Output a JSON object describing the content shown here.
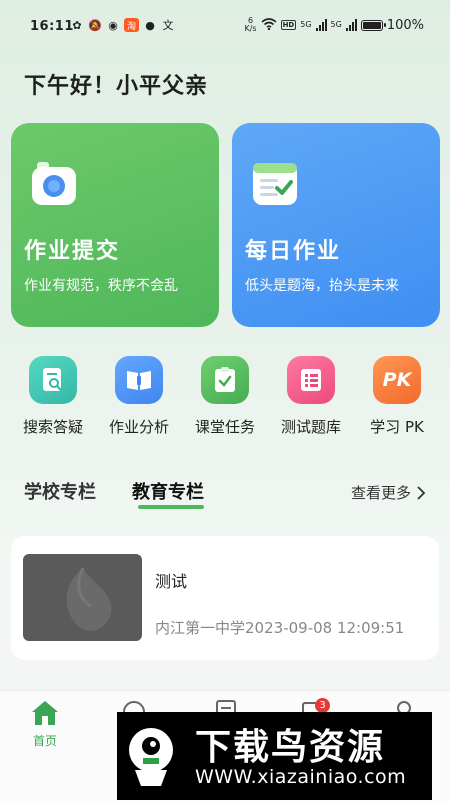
{
  "status_bar": {
    "time": "16:11",
    "net_speed_value": "6",
    "net_speed_unit": "K/s",
    "hd_label": "HD",
    "signal1_label": "5G",
    "signal2_label": "5G",
    "battery_pct": "100%",
    "taobao_label": "淘",
    "wen_label": "文"
  },
  "greeting": "下午好！小平父亲",
  "cards": [
    {
      "title": "作业提交",
      "subtitle": "作业有规范，秩序不会乱",
      "color": "#56bb5c",
      "icon": "camera-icon"
    },
    {
      "title": "每日作业",
      "subtitle": "低头是题海，抬头是未来",
      "color": "#4a96f4",
      "icon": "checklist-icon"
    }
  ],
  "shortcuts": [
    {
      "label": "搜索答疑",
      "color": "#3ec8b4",
      "icon": "book-search-icon"
    },
    {
      "label": "作业分析",
      "color": "#4a8ef0",
      "icon": "open-book-icon"
    },
    {
      "label": "课堂任务",
      "color": "#4fb75a",
      "icon": "task-icon"
    },
    {
      "label": "测试题库",
      "color": "#f25a8a",
      "icon": "question-bank-icon"
    },
    {
      "label": "学习 PK",
      "color": "#ff7a3d",
      "icon": "pk-icon",
      "icon_text": "PK"
    }
  ],
  "section": {
    "tabs": [
      "学校专栏",
      "教育专栏"
    ],
    "active_tab": 1,
    "more_label": "查看更多"
  },
  "news_items": [
    {
      "title": "测试",
      "source": "内江第一中学",
      "datetime": "2023-09-08 12:09:51"
    }
  ],
  "bottom_nav": {
    "items": [
      {
        "label": "首页",
        "icon": "home-icon",
        "active": true
      },
      {
        "label": "",
        "icon": "message-icon"
      },
      {
        "label": "",
        "icon": "homework-icon"
      },
      {
        "label": "",
        "icon": "notice-icon",
        "badge": "3"
      },
      {
        "label": "",
        "icon": "profile-icon"
      }
    ]
  },
  "watermark": {
    "title": "下载鸟资源",
    "url": "WWW.xiazainiao.com"
  },
  "colors": {
    "accent_green": "#4fb75a",
    "accent_blue": "#4a96f4",
    "badge_red": "#e53935"
  }
}
